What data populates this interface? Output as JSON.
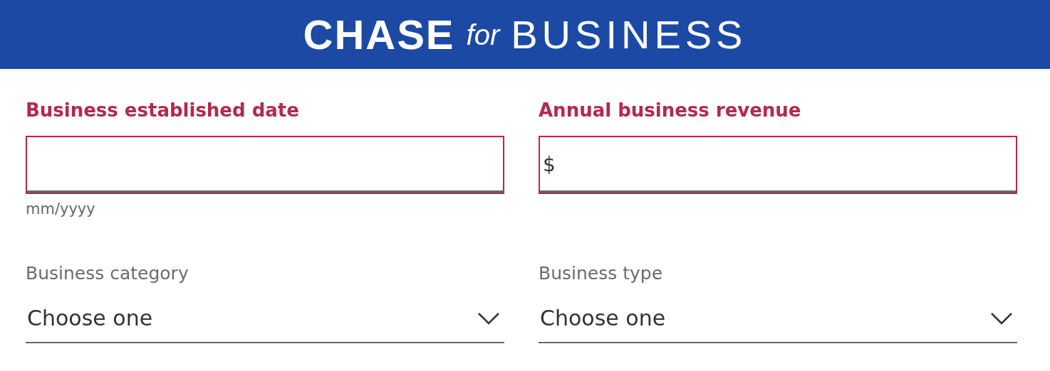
{
  "header": {
    "logo": {
      "brand": "CHASE",
      "connector": "for",
      "product": "BUSINESS"
    }
  },
  "fields": [
    {
      "kind": "text",
      "label": "Business established date",
      "error": true,
      "helper": "mm/yyyy"
    },
    {
      "kind": "text",
      "label": "Annual business revenue",
      "error": true,
      "prefix": "$"
    },
    {
      "kind": "select",
      "label": "Business category",
      "value": "Choose one"
    },
    {
      "kind": "select",
      "label": "Business type",
      "value": "Choose one"
    }
  ]
}
